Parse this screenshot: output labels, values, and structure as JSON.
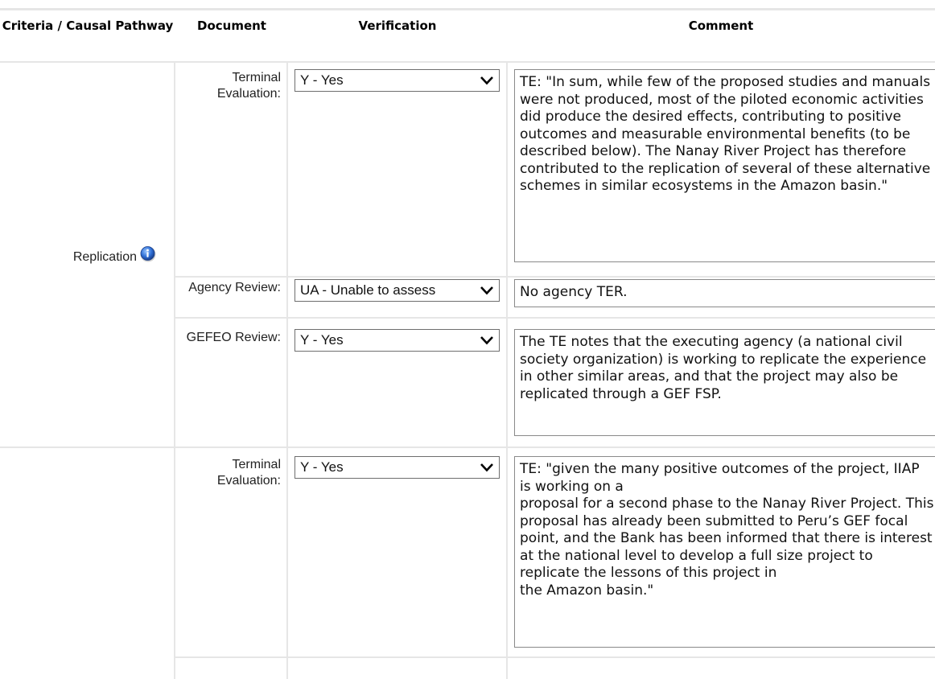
{
  "table": {
    "headers": {
      "criteria": "Criteria / Causal Pathway",
      "document": "Document",
      "verification": "Verification",
      "comment": "Comment"
    }
  },
  "sections": [
    {
      "criteria": "Replication",
      "icon": "info-icon",
      "rows": [
        {
          "document": "Terminal Evaluation:",
          "verification": "Y - Yes",
          "comment": "TE: \"In sum, while few of the proposed studies and manuals were not produced, most of the piloted economic activities did produce the desired effects, contributing to positive outcomes and measurable environmental benefits (to be described below).  The Nanay River Project has therefore contributed to the replication of several of these alternative schemes in similar ecosystems in the Amazon basin.\""
        },
        {
          "document": "Agency Review:",
          "verification": "UA - Unable to assess",
          "comment": "No agency TER."
        },
        {
          "document": "GEFEO Review:",
          "verification": "Y - Yes",
          "comment": "The TE notes that the executing agency (a national civil society organization) is working to replicate the experience in other similar areas, and that the project may also be replicated through a GEF FSP."
        }
      ]
    },
    {
      "criteria": "",
      "rows": [
        {
          "document": "Terminal Evaluation:",
          "verification": "Y - Yes",
          "comment": "TE: \"given the many positive outcomes of the project, IIAP is working on a\nproposal for a second phase to the Nanay River Project.  This proposal has already been submitted to Peru’s GEF focal point, and the Bank has been informed that there is interest\nat the national level to develop a full size project to replicate the lessons of this project in\nthe Amazon basin.\""
        }
      ]
    }
  ],
  "colors": {
    "grid": "#e6e6e6",
    "border": "#8a8a8a",
    "icon_blue": "#2f6fd6"
  }
}
